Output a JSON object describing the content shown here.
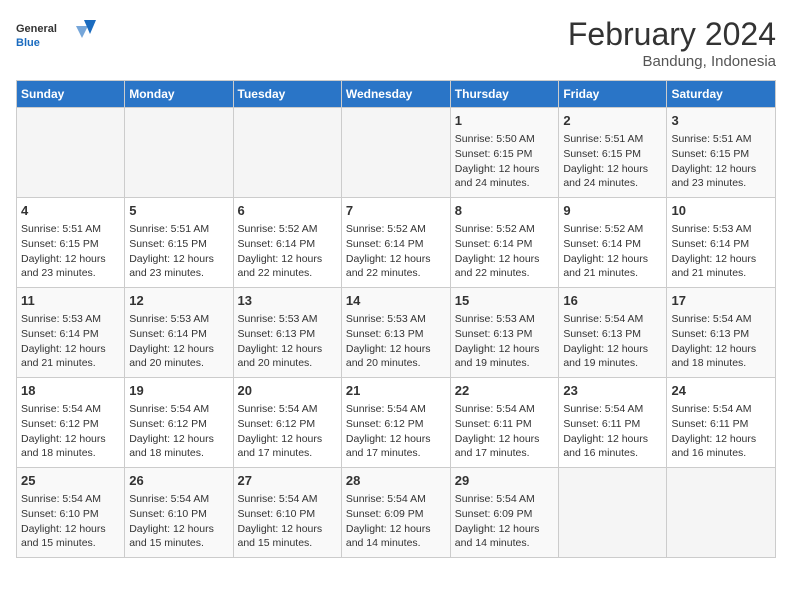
{
  "header": {
    "logo_general": "General",
    "logo_blue": "Blue",
    "title": "February 2024",
    "subtitle": "Bandung, Indonesia"
  },
  "calendar": {
    "days_of_week": [
      "Sunday",
      "Monday",
      "Tuesday",
      "Wednesday",
      "Thursday",
      "Friday",
      "Saturday"
    ],
    "weeks": [
      [
        {
          "day": "",
          "info": ""
        },
        {
          "day": "",
          "info": ""
        },
        {
          "day": "",
          "info": ""
        },
        {
          "day": "",
          "info": ""
        },
        {
          "day": "1",
          "info": "Sunrise: 5:50 AM\nSunset: 6:15 PM\nDaylight: 12 hours\nand 24 minutes."
        },
        {
          "day": "2",
          "info": "Sunrise: 5:51 AM\nSunset: 6:15 PM\nDaylight: 12 hours\nand 24 minutes."
        },
        {
          "day": "3",
          "info": "Sunrise: 5:51 AM\nSunset: 6:15 PM\nDaylight: 12 hours\nand 23 minutes."
        }
      ],
      [
        {
          "day": "4",
          "info": "Sunrise: 5:51 AM\nSunset: 6:15 PM\nDaylight: 12 hours\nand 23 minutes."
        },
        {
          "day": "5",
          "info": "Sunrise: 5:51 AM\nSunset: 6:15 PM\nDaylight: 12 hours\nand 23 minutes."
        },
        {
          "day": "6",
          "info": "Sunrise: 5:52 AM\nSunset: 6:14 PM\nDaylight: 12 hours\nand 22 minutes."
        },
        {
          "day": "7",
          "info": "Sunrise: 5:52 AM\nSunset: 6:14 PM\nDaylight: 12 hours\nand 22 minutes."
        },
        {
          "day": "8",
          "info": "Sunrise: 5:52 AM\nSunset: 6:14 PM\nDaylight: 12 hours\nand 22 minutes."
        },
        {
          "day": "9",
          "info": "Sunrise: 5:52 AM\nSunset: 6:14 PM\nDaylight: 12 hours\nand 21 minutes."
        },
        {
          "day": "10",
          "info": "Sunrise: 5:53 AM\nSunset: 6:14 PM\nDaylight: 12 hours\nand 21 minutes."
        }
      ],
      [
        {
          "day": "11",
          "info": "Sunrise: 5:53 AM\nSunset: 6:14 PM\nDaylight: 12 hours\nand 21 minutes."
        },
        {
          "day": "12",
          "info": "Sunrise: 5:53 AM\nSunset: 6:14 PM\nDaylight: 12 hours\nand 20 minutes."
        },
        {
          "day": "13",
          "info": "Sunrise: 5:53 AM\nSunset: 6:13 PM\nDaylight: 12 hours\nand 20 minutes."
        },
        {
          "day": "14",
          "info": "Sunrise: 5:53 AM\nSunset: 6:13 PM\nDaylight: 12 hours\nand 20 minutes."
        },
        {
          "day": "15",
          "info": "Sunrise: 5:53 AM\nSunset: 6:13 PM\nDaylight: 12 hours\nand 19 minutes."
        },
        {
          "day": "16",
          "info": "Sunrise: 5:54 AM\nSunset: 6:13 PM\nDaylight: 12 hours\nand 19 minutes."
        },
        {
          "day": "17",
          "info": "Sunrise: 5:54 AM\nSunset: 6:13 PM\nDaylight: 12 hours\nand 18 minutes."
        }
      ],
      [
        {
          "day": "18",
          "info": "Sunrise: 5:54 AM\nSunset: 6:12 PM\nDaylight: 12 hours\nand 18 minutes."
        },
        {
          "day": "19",
          "info": "Sunrise: 5:54 AM\nSunset: 6:12 PM\nDaylight: 12 hours\nand 18 minutes."
        },
        {
          "day": "20",
          "info": "Sunrise: 5:54 AM\nSunset: 6:12 PM\nDaylight: 12 hours\nand 17 minutes."
        },
        {
          "day": "21",
          "info": "Sunrise: 5:54 AM\nSunset: 6:12 PM\nDaylight: 12 hours\nand 17 minutes."
        },
        {
          "day": "22",
          "info": "Sunrise: 5:54 AM\nSunset: 6:11 PM\nDaylight: 12 hours\nand 17 minutes."
        },
        {
          "day": "23",
          "info": "Sunrise: 5:54 AM\nSunset: 6:11 PM\nDaylight: 12 hours\nand 16 minutes."
        },
        {
          "day": "24",
          "info": "Sunrise: 5:54 AM\nSunset: 6:11 PM\nDaylight: 12 hours\nand 16 minutes."
        }
      ],
      [
        {
          "day": "25",
          "info": "Sunrise: 5:54 AM\nSunset: 6:10 PM\nDaylight: 12 hours\nand 15 minutes."
        },
        {
          "day": "26",
          "info": "Sunrise: 5:54 AM\nSunset: 6:10 PM\nDaylight: 12 hours\nand 15 minutes."
        },
        {
          "day": "27",
          "info": "Sunrise: 5:54 AM\nSunset: 6:10 PM\nDaylight: 12 hours\nand 15 minutes."
        },
        {
          "day": "28",
          "info": "Sunrise: 5:54 AM\nSunset: 6:09 PM\nDaylight: 12 hours\nand 14 minutes."
        },
        {
          "day": "29",
          "info": "Sunrise: 5:54 AM\nSunset: 6:09 PM\nDaylight: 12 hours\nand 14 minutes."
        },
        {
          "day": "",
          "info": ""
        },
        {
          "day": "",
          "info": ""
        }
      ]
    ]
  }
}
